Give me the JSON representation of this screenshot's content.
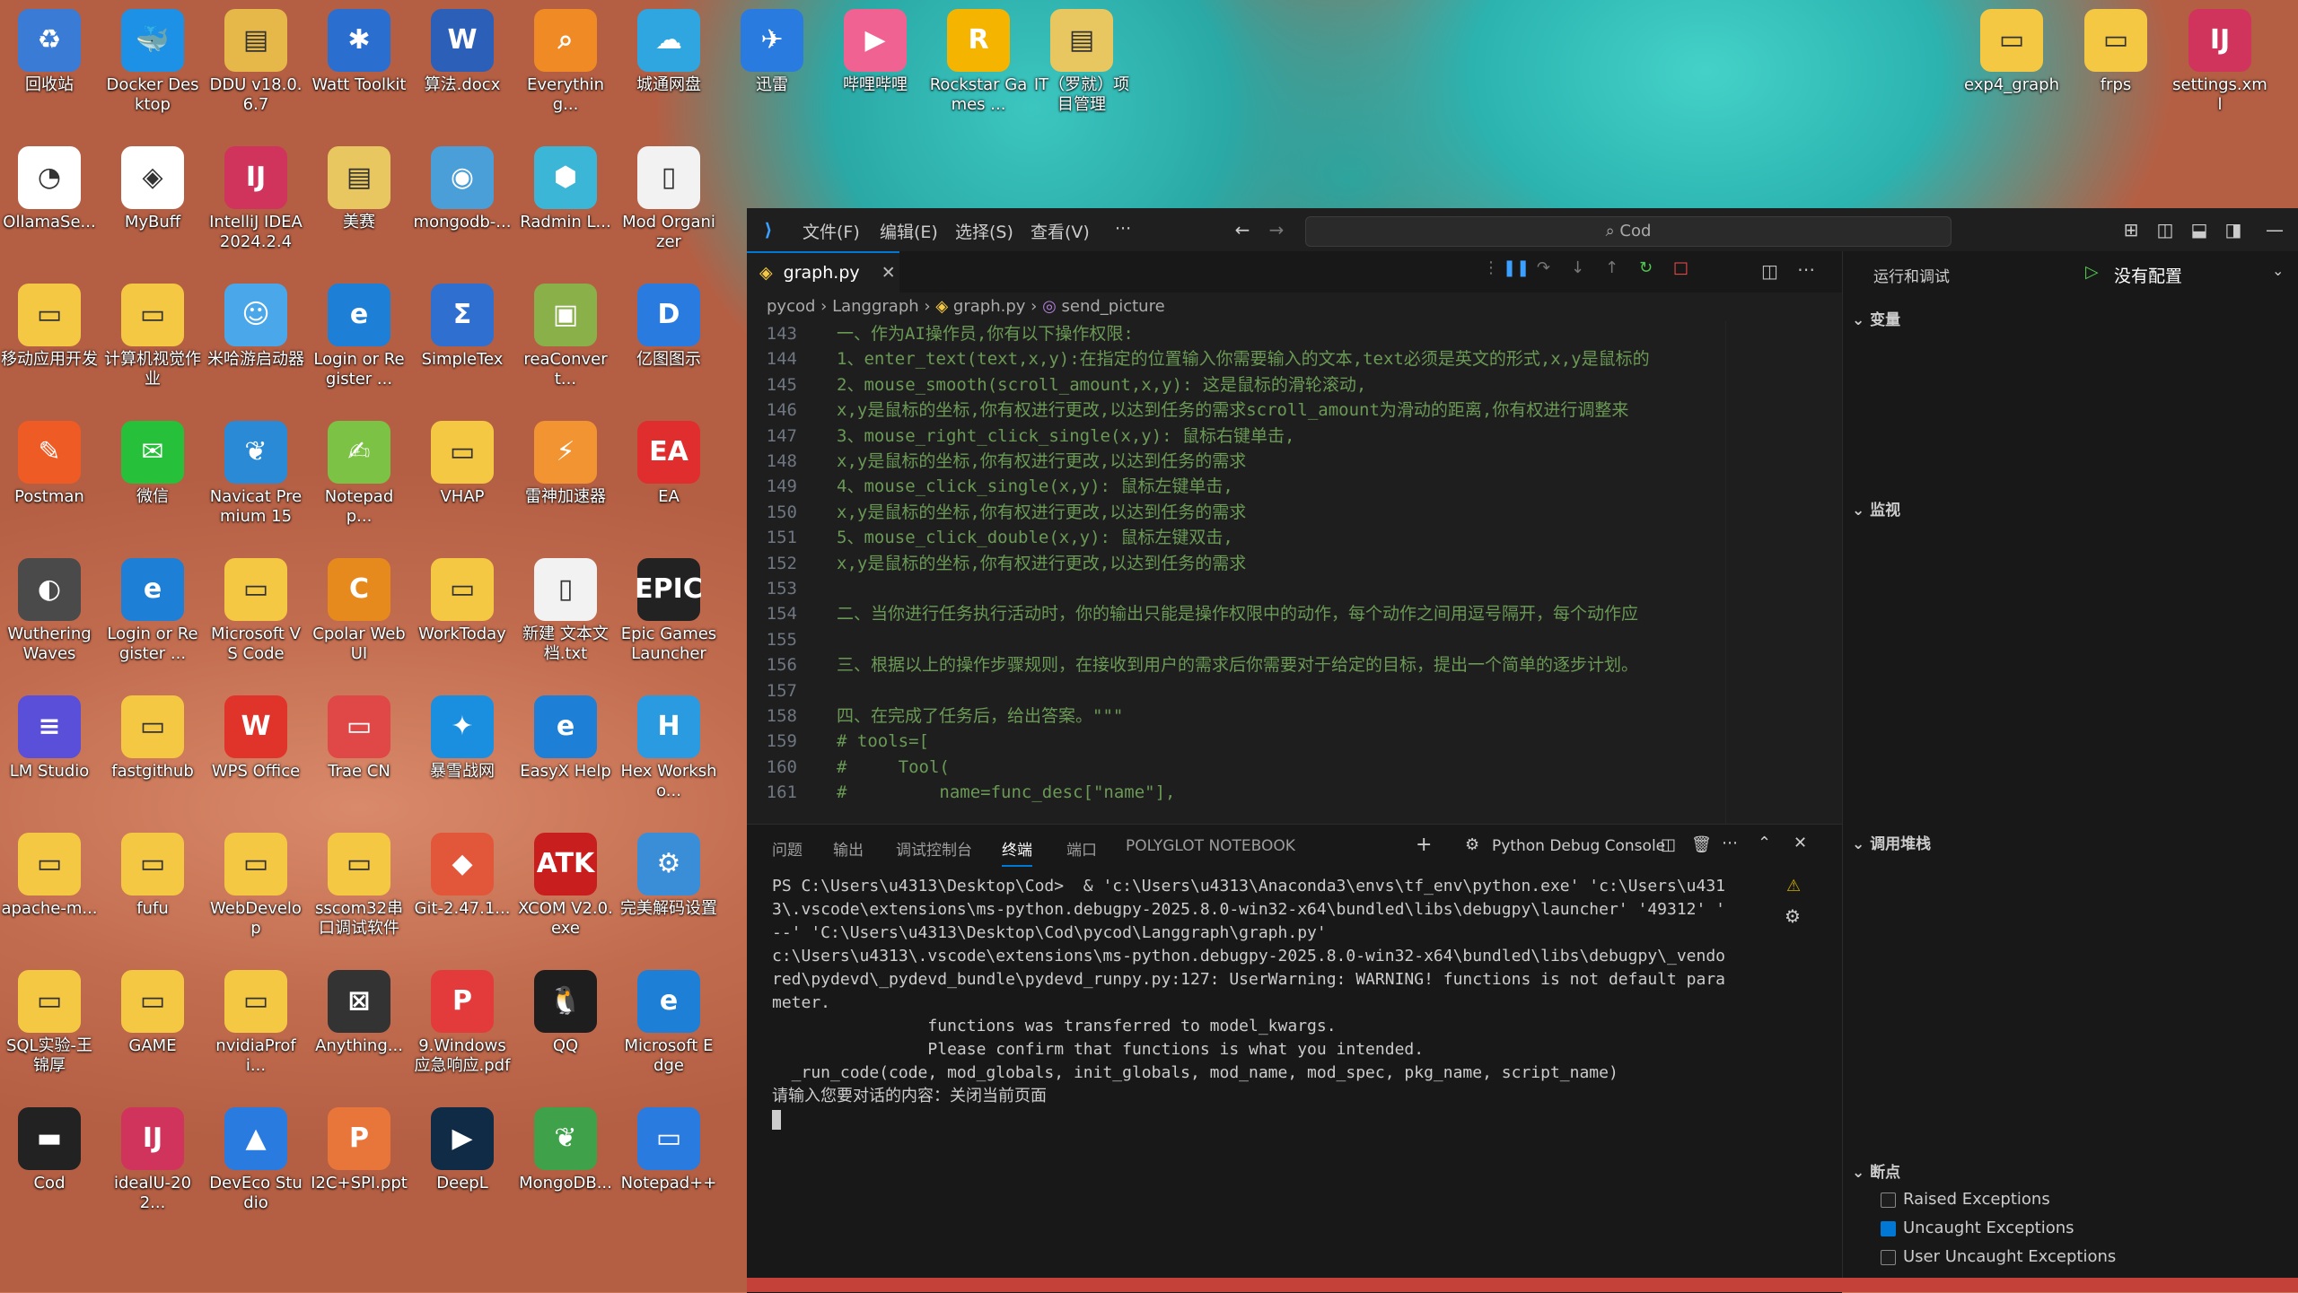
{
  "desktop": {
    "icons": [
      {
        "label": "回收站",
        "color": "#3a7bd5",
        "glyph": "♻"
      },
      {
        "label": "Docker Desktop",
        "color": "#1d91e6",
        "glyph": "🐳"
      },
      {
        "label": "DDU v18.0.6.7",
        "color": "#e6b84a",
        "glyph": "▤"
      },
      {
        "label": "Watt Toolkit",
        "color": "#2a6fd0",
        "glyph": "✱"
      },
      {
        "label": "算法.docx",
        "color": "#2b5fb8",
        "glyph": "W"
      },
      {
        "label": "Everything...",
        "color": "#f08a24",
        "glyph": "⌕"
      },
      {
        "label": "城通网盘",
        "color": "#2fa6e0",
        "glyph": "☁"
      },
      {
        "label": "迅雷",
        "color": "#2a7be0",
        "glyph": "✈"
      },
      {
        "label": "哔哩哔哩",
        "color": "#f06292",
        "glyph": "▶"
      },
      {
        "label": "Rockstar Games ...",
        "color": "#f5b400",
        "glyph": "R"
      },
      {
        "label": "IT（罗就）项目管理",
        "color": "#e8c660",
        "glyph": "▤"
      },
      {
        "label": "OllamaSe...",
        "color": "#ffffff",
        "glyph": "◔"
      },
      {
        "label": "MyBuff",
        "color": "#ffffff",
        "glyph": "◈"
      },
      {
        "label": "IntelliJ IDEA 2024.2.4",
        "color": "#d0335c",
        "glyph": "IJ"
      },
      {
        "label": "美赛",
        "color": "#e8c660",
        "glyph": "▤"
      },
      {
        "label": "mongodb-...",
        "color": "#4a9fd8",
        "glyph": "◉"
      },
      {
        "label": "Radmin L...",
        "color": "#3bb6d6",
        "glyph": "⬢"
      },
      {
        "label": "Mod Organizer",
        "color": "#f2f2f2",
        "glyph": "▯"
      },
      {
        "label": "移动应用开发",
        "color": "#f5c843",
        "glyph": "▭"
      },
      {
        "label": "计算机视觉作业",
        "color": "#f5c843",
        "glyph": "▭"
      },
      {
        "label": "米哈游启动器",
        "color": "#4aa8ea",
        "glyph": "☺"
      },
      {
        "label": "Login or Register ...",
        "color": "#1e7fd6",
        "glyph": "e"
      },
      {
        "label": "SimpleTex",
        "color": "#2f6fd0",
        "glyph": "Σ"
      },
      {
        "label": "reaConvert...",
        "color": "#8ab04a",
        "glyph": "▣"
      },
      {
        "label": "亿图图示",
        "color": "#2a7be0",
        "glyph": "D"
      },
      {
        "label": "Postman",
        "color": "#ef5b25",
        "glyph": "✎"
      },
      {
        "label": "微信",
        "color": "#27c03a",
        "glyph": "✉"
      },
      {
        "label": "Navicat Premium 15",
        "color": "#2a8ad6",
        "glyph": "❦"
      },
      {
        "label": "Notepad p...",
        "color": "#7cc244",
        "glyph": "✍"
      },
      {
        "label": "VHAP",
        "color": "#f5c843",
        "glyph": "▭"
      },
      {
        "label": "雷神加速器",
        "color": "#f29432",
        "glyph": "⚡"
      },
      {
        "label": "EA",
        "color": "#e02d2d",
        "glyph": "EA"
      },
      {
        "label": "Wuthering Waves",
        "color": "#4a4a4a",
        "glyph": "◐"
      },
      {
        "label": "Login or Register ...",
        "color": "#1e7fd6",
        "glyph": "e"
      },
      {
        "label": "Microsoft VS Code",
        "color": "#f5c843",
        "glyph": "▭"
      },
      {
        "label": "Cpolar Web UI",
        "color": "#e68a1e",
        "glyph": "C"
      },
      {
        "label": "WorkToday",
        "color": "#f5c843",
        "glyph": "▭"
      },
      {
        "label": "新建 文本文档.txt",
        "color": "#f2f2f2",
        "glyph": "▯"
      },
      {
        "label": "Epic Games Launcher",
        "color": "#222222",
        "glyph": "EPIC"
      },
      {
        "label": "LM Studio",
        "color": "#5a4fd8",
        "glyph": "≡"
      },
      {
        "label": "fastgithub",
        "color": "#f5c843",
        "glyph": "▭"
      },
      {
        "label": "WPS Office",
        "color": "#e0342b",
        "glyph": "W"
      },
      {
        "label": "Trae CN",
        "color": "#e04848",
        "glyph": "▭"
      },
      {
        "label": "暴雪战网",
        "color": "#1a8fe0",
        "glyph": "✦"
      },
      {
        "label": "EasyX Help",
        "color": "#1e7fd6",
        "glyph": "e"
      },
      {
        "label": "Hex Worksho...",
        "color": "#2a9be0",
        "glyph": "H"
      },
      {
        "label": "apache-m...",
        "color": "#f5c843",
        "glyph": "▭"
      },
      {
        "label": "fufu",
        "color": "#f5c843",
        "glyph": "▭"
      },
      {
        "label": "WebDevelop",
        "color": "#f5c843",
        "glyph": "▭"
      },
      {
        "label": "sscom32串口调试软件",
        "color": "#f5c843",
        "glyph": "▭"
      },
      {
        "label": "Git-2.47.1...",
        "color": "#e2573a",
        "glyph": "◆"
      },
      {
        "label": "XCOM V2.0.exe",
        "color": "#c81e1e",
        "glyph": "ATK"
      },
      {
        "label": "完美解码设置",
        "color": "#3a8ed8",
        "glyph": "⚙"
      },
      {
        "label": "SQL实验-王锦厚",
        "color": "#f5c843",
        "glyph": "▭"
      },
      {
        "label": "GAME",
        "color": "#f5c843",
        "glyph": "▭"
      },
      {
        "label": "nvidiaProfi...",
        "color": "#f5c843",
        "glyph": "▭"
      },
      {
        "label": "Anything...",
        "color": "#333333",
        "glyph": "⊠"
      },
      {
        "label": "9.Windows应急响应.pdf",
        "color": "#e33b3b",
        "glyph": "P"
      },
      {
        "label": "QQ",
        "color": "#1e1e1e",
        "glyph": "🐧"
      },
      {
        "label": "Microsoft Edge",
        "color": "#1e7fd6",
        "glyph": "e"
      },
      {
        "label": "Cod",
        "color": "#222222",
        "glyph": "▬"
      },
      {
        "label": "idealU-202...",
        "color": "#d0335c",
        "glyph": "IJ"
      },
      {
        "label": "DevEco Studio",
        "color": "#2a7be0",
        "glyph": "▲"
      },
      {
        "label": "I2C+SPI.ppt",
        "color": "#e8763a",
        "glyph": "P"
      },
      {
        "label": "DeepL",
        "color": "#0f2b46",
        "glyph": "▶"
      },
      {
        "label": "MongoDB...",
        "color": "#3fa14a",
        "glyph": "❦"
      },
      {
        "label": "Notepad++",
        "color": "#2a7be0",
        "glyph": "▭"
      }
    ],
    "top_icons_right": [
      {
        "label": "exp4_graph",
        "color": "#f5c843",
        "glyph": "▭"
      },
      {
        "label": "frps",
        "color": "#f5c843",
        "glyph": "▭"
      },
      {
        "label": "settings.xml",
        "color": "#d0335c",
        "glyph": "IJ"
      }
    ]
  },
  "vscode": {
    "menus": [
      "文件(F)",
      "编辑(E)",
      "选择(S)",
      "查看(V)",
      "···"
    ],
    "search_text": "Cod",
    "tab_label": "graph.py",
    "breadcrumb": [
      "pycod",
      "Langgraph",
      "graph.py",
      "send_picture"
    ],
    "code_lines": [
      {
        "n": "143",
        "t": "一、作为AI操作员,你有以下操作权限:"
      },
      {
        "n": "144",
        "t": "1、enter_text(text,x,y):在指定的位置输入你需要输入的文本,text必须是英文的形式,x,y是鼠标的"
      },
      {
        "n": "145",
        "t": "2、mouse_smooth(scroll_amount,x,y): 这是鼠标的滑轮滚动,"
      },
      {
        "n": "146",
        "t": "x,y是鼠标的坐标,你有权进行更改,以达到任务的需求scroll_amount为滑动的距离,你有权进行调整来"
      },
      {
        "n": "147",
        "t": "3、mouse_right_click_single(x,y): 鼠标右键单击,"
      },
      {
        "n": "148",
        "t": "x,y是鼠标的坐标,你有权进行更改,以达到任务的需求"
      },
      {
        "n": "149",
        "t": "4、mouse_click_single(x,y): 鼠标左键单击,"
      },
      {
        "n": "150",
        "t": "x,y是鼠标的坐标,你有权进行更改,以达到任务的需求"
      },
      {
        "n": "151",
        "t": "5、mouse_click_double(x,y): 鼠标左键双击,"
      },
      {
        "n": "152",
        "t": "x,y是鼠标的坐标,你有权进行更改,以达到任务的需求"
      },
      {
        "n": "153",
        "t": ""
      },
      {
        "n": "154",
        "t": "二、当你进行任务执行活动时，你的输出只能是操作权限中的动作，每个动作之间用逗号隔开，每个动作应"
      },
      {
        "n": "155",
        "t": ""
      },
      {
        "n": "156",
        "t": "三、根据以上的操作步骤规则，在接收到用户的需求后你需要对于给定的目标，提出一个简单的逐步计划。"
      },
      {
        "n": "157",
        "t": ""
      },
      {
        "n": "158",
        "t": "四、在完成了任务后，给出答案。\"\"\""
      },
      {
        "n": "159",
        "t": "# tools=["
      },
      {
        "n": "160",
        "t": "#     Tool("
      },
      {
        "n": "161",
        "t": "#         name=func_desc[\"name\"],"
      }
    ],
    "panel_tabs": [
      "问题",
      "输出",
      "调试控制台",
      "终端",
      "端口",
      "POLYGLOT NOTEBOOK"
    ],
    "debug_console_label": "Python Debug Console",
    "terminal_lines": [
      "PS C:\\Users\\u4313\\Desktop\\Cod>  & 'c:\\Users\\u4313\\Anaconda3\\envs\\tf_env\\python.exe' 'c:\\Users\\u431",
      "3\\.vscode\\extensions\\ms-python.debugpy-2025.8.0-win32-x64\\bundled\\libs\\debugpy\\launcher' '49312' '",
      "--' 'C:\\Users\\u4313\\Desktop\\Cod\\pycod\\Langgraph\\graph.py'",
      "c:\\Users\\u4313\\.vscode\\extensions\\ms-python.debugpy-2025.8.0-win32-x64\\bundled\\libs\\debugpy\\_vendo",
      "red\\pydevd\\_pydevd_bundle\\pydevd_runpy.py:127: UserWarning: WARNING! functions is not default para",
      "meter.",
      "                functions was transferred to model_kwargs.",
      "                Please confirm that functions is what you intended.",
      "  _run_code(code, mod_globals, init_globals, mod_name, mod_spec, pkg_name, script_name)",
      "请输入您要对话的内容：关闭当前页面"
    ],
    "run_debug": {
      "title": "运行和调试",
      "config": "没有配置",
      "sections": {
        "variables": "变量",
        "watch": "监视",
        "callstack": "调用堆栈",
        "breakpoints": "断点"
      },
      "breakpoints": [
        {
          "label": "Raised Exceptions",
          "checked": false
        },
        {
          "label": "Uncaught Exceptions",
          "checked": true
        },
        {
          "label": "User Uncaught Exceptions",
          "checked": false
        }
      ]
    },
    "colors": {
      "accent": "#0078d4",
      "statusbar": "#c4413a",
      "comment": "#6a9955"
    }
  }
}
